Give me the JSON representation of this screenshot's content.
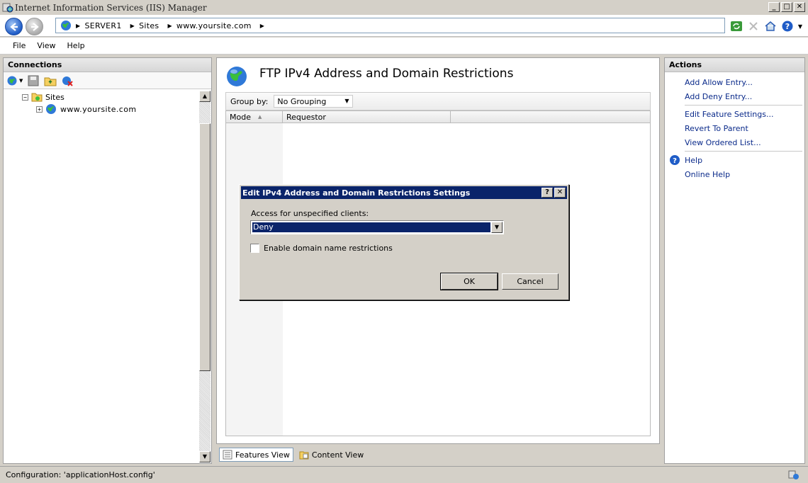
{
  "window": {
    "title": "Internet Information Services (IIS) Manager",
    "minimize": "_",
    "maximize": "□",
    "close": "✕"
  },
  "address": {
    "segments": [
      "SERVER1",
      "Sites",
      "www.yoursite.com"
    ]
  },
  "menu": {
    "items": [
      "File",
      "View",
      "Help"
    ]
  },
  "connections": {
    "header": "Connections",
    "tree": {
      "sites_label": "Sites",
      "site_label": "www.yoursite.com",
      "sites_expander": "−",
      "site_expander": "+"
    }
  },
  "feature": {
    "title": "FTP IPv4 Address and Domain Restrictions",
    "group_by_label": "Group by:",
    "group_by_value": "No Grouping",
    "columns": [
      "Mode",
      "Requestor"
    ]
  },
  "view_tabs": {
    "features": "Features View",
    "content": "Content View"
  },
  "actions": {
    "header": "Actions",
    "add_allow": "Add Allow Entry...",
    "add_deny": "Add Deny Entry...",
    "edit_settings": "Edit Feature Settings...",
    "revert": "Revert To Parent",
    "view_ordered": "View Ordered List...",
    "help": "Help",
    "online_help": "Online Help"
  },
  "dialog": {
    "title": "Edit IPv4 Address and Domain Restrictions Settings",
    "help_btn": "?",
    "close_btn": "✕",
    "access_label": "Access for unspecified clients:",
    "access_value": "Deny",
    "domain_checkbox_label": "Enable domain name restrictions",
    "ok": "OK",
    "cancel": "Cancel"
  },
  "status": {
    "text": "Configuration: 'applicationHost.config'"
  }
}
